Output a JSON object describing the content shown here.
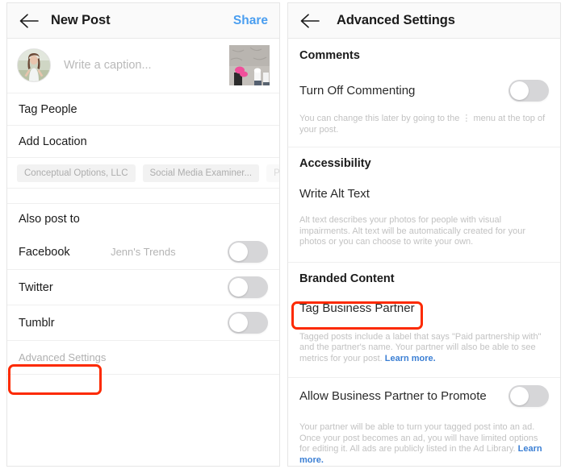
{
  "left_panel": {
    "appbar": {
      "back_icon": "arrow-left-icon",
      "title": "New Post",
      "action_label": "Share"
    },
    "composer": {
      "avatar_alt": "user-avatar",
      "caption_placeholder": "Write a caption...",
      "thumbnail_alt": "post-thumbnail"
    },
    "rows": [
      {
        "label": "Tag People"
      },
      {
        "label": "Add Location"
      }
    ],
    "location_chips": [
      {
        "label": "Conceptual Options, LLC"
      },
      {
        "label": "Social Media Examiner..."
      },
      {
        "label": "Pow"
      }
    ],
    "also_post_to": {
      "title": "Also post to",
      "services": [
        {
          "label": "Facebook",
          "account": "Jenn's Trends",
          "toggle_state": "off"
        },
        {
          "label": "Twitter",
          "account": "",
          "toggle_state": "off"
        },
        {
          "label": "Tumblr",
          "account": "",
          "toggle_state": "off"
        }
      ]
    },
    "advanced_settings_label": "Advanced Settings"
  },
  "right_panel": {
    "appbar": {
      "back_icon": "arrow-left-icon",
      "title": "Advanced Settings"
    },
    "sections": [
      {
        "heading": "Comments",
        "item_label": "Turn Off Commenting",
        "toggle_state": "off",
        "help_before_dots": "You can change this later by going to the",
        "dots_glyph": "⋮",
        "help_after_dots": "menu at the top of your post."
      },
      {
        "heading": "Accessibility",
        "item_label": "Write Alt Text",
        "help": "Alt text describes your photos for people with visual impairments. Alt text will be automatically created for your photos or you can choose to write your own."
      },
      {
        "heading": "Branded Content",
        "item_label": "Tag Business Partner",
        "help": "Tagged posts include a label that says \"Paid partnership with\" and the partner's name. Your partner will also be able to see metrics for your post.",
        "link_label": "Learn more."
      },
      {
        "item_label": "Allow Business Partner to Promote",
        "toggle_state": "off",
        "help": "Your partner will be able to turn your tagged post into an ad. Once your post becomes an ad, you will have limited options for editing it. All ads are publicly listed in the Ad Library.",
        "link_label": "Learn more."
      }
    ]
  },
  "annotations": [
    {
      "name": "advanced-settings-highlight",
      "color": "#fc2a00"
    },
    {
      "name": "tag-business-partner-highlight",
      "color": "#fc2a00"
    }
  ],
  "colors": {
    "accent_blue": "#4a9ef0",
    "link_blue": "#3b7fd4",
    "annotation_red": "#fc2a00",
    "toggle_track_off": "#d6d6d8",
    "muted_text": "#b4b4b4"
  }
}
